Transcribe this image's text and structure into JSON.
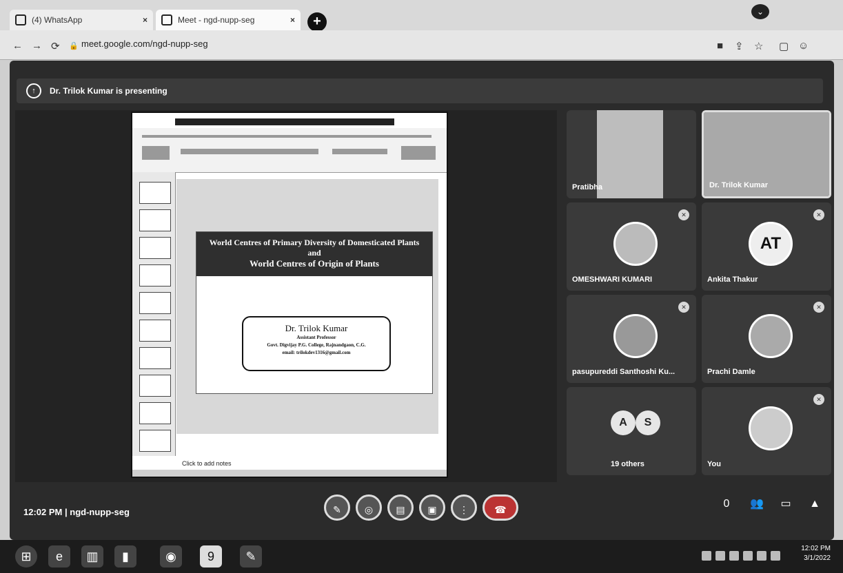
{
  "browser": {
    "tabs": [
      {
        "label": "(4) WhatsApp"
      },
      {
        "label": "Meet - ngd-nupp-seg"
      }
    ],
    "new_tab": "+",
    "url": "meet.google.com/ngd-nupp-seg"
  },
  "meet": {
    "presenting_banner": "Dr. Trilok Kumar is presenting",
    "slide": {
      "title_line1": "World Centres of Primary Diversity of Domesticated Plants",
      "title_line2": "and",
      "title_line3": "World Centres of Origin of Plants",
      "author_name": "Dr. Trilok Kumar",
      "author_title": "Assistant Professor",
      "author_college": "Govt. Digvijay P.G. College, Rajnandgaon, C.G.",
      "author_email": "email: trilokdev1316@gmail.com"
    },
    "notes_placeholder": "Click to add notes",
    "participants": [
      {
        "name": "Pratibha"
      },
      {
        "name": "Dr. Trilok Kumar"
      },
      {
        "name": "OMESHWARI KUMARI"
      },
      {
        "name": "Ankita Thakur",
        "initials": "AT"
      },
      {
        "name": "pasupureddi Santhoshi Ku..."
      },
      {
        "name": "Prachi Damle"
      },
      {
        "name": "19 others",
        "initials": [
          "A",
          "S"
        ]
      },
      {
        "name": "You"
      }
    ],
    "time": "12:02 PM",
    "separator": "|",
    "meeting_code": "ngd-nupp-seg",
    "info_count": "0"
  },
  "taskbar": {
    "clock_time": "12:02 PM",
    "clock_date": "3/1/2022"
  }
}
